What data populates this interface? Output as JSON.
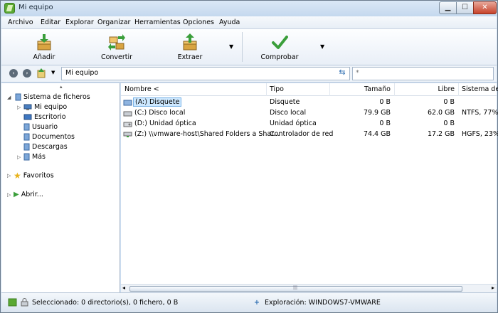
{
  "window": {
    "title": "Mi equipo",
    "min": "▁",
    "max": "☐",
    "close": "✕"
  },
  "menu": [
    "Archivo",
    "Editar",
    "Explorar",
    "Organizar",
    "Herramientas",
    "Opciones",
    "Ayuda"
  ],
  "toolbar": {
    "add": "Añadir",
    "convert": "Convertir",
    "extract": "Extraer",
    "check": "Comprobar",
    "dropdown_glyph": "▼"
  },
  "address": {
    "back": "‹",
    "forward": "›",
    "path": "Mi equipo",
    "refresh": "⇆",
    "search_placeholder": "*"
  },
  "tree": {
    "collapse_marker": "▴",
    "root": "Sistema de ficheros",
    "items": [
      "Mi equipo",
      "Escritorio",
      "Usuario",
      "Documentos",
      "Descargas",
      "Más"
    ],
    "favorites": "Favoritos",
    "open": "Abrir..."
  },
  "columns": [
    "Nombre <",
    "Tipo",
    "Tamaño",
    "Libre",
    "Sistema de"
  ],
  "rows": [
    {
      "name": "(A:) Disquete",
      "type": "Disquete",
      "size": "0 B",
      "free": "0 B",
      "fs": ""
    },
    {
      "name": "(C:) Disco local",
      "type": "Disco local",
      "size": "79.9 GB",
      "free": "62.0 GB",
      "fs": "NTFS, 77%"
    },
    {
      "name": "(D:) Unidad óptica",
      "type": "Unidad óptica",
      "size": "0 B",
      "free": "0 B",
      "fs": ""
    },
    {
      "name": "(Z:) \\\\vmware-host\\Shared Folders a Shar...",
      "type": "Controlador de red",
      "size": "74.4 GB",
      "free": "17.2 GB",
      "fs": "HGFS, 23%"
    }
  ],
  "scroll": {
    "left": "◂",
    "right": "▸",
    "grip": "|||"
  },
  "status": {
    "selected": "Seleccionado: 0 directorio(s), 0 fichero, 0 B",
    "explore_plus": "+",
    "explore": "Exploración: WINDOWS7-VMWARE"
  },
  "colors": {
    "accent": "#2b6cb1",
    "selection": "#cde8ff",
    "titlebar": "#c4d8ee",
    "brand_green": "#5aa832"
  }
}
